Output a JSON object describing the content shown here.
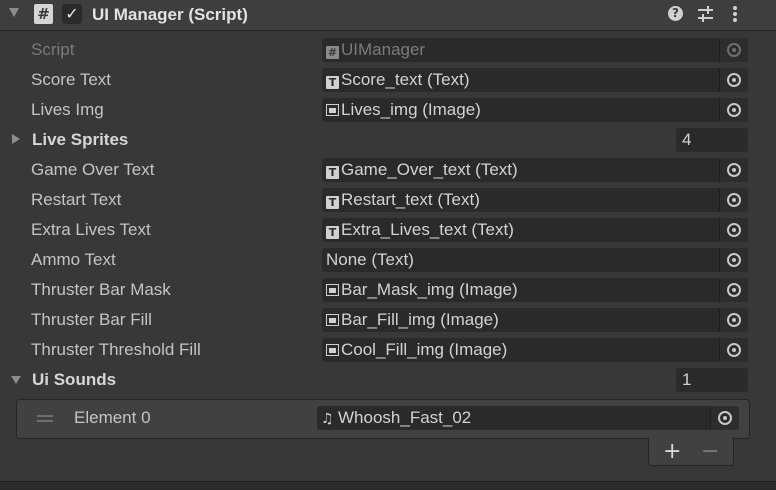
{
  "header": {
    "title": "UI Manager (Script)",
    "script_icon": "#",
    "checkbox_icon": "checkmark-icon",
    "help_icon": "?",
    "presets_icon": "sliders-icon",
    "menu_icon": "kebab-menu-icon"
  },
  "fields": [
    {
      "label": "Script",
      "value": "UIManager",
      "icon": "script-icon",
      "disabled": true
    },
    {
      "label": "Score Text",
      "value": "Score_text (Text)",
      "icon": "text-icon"
    },
    {
      "label": "Lives Img",
      "value": "Lives_img (Image)",
      "icon": "image-icon"
    },
    {
      "label": "Live Sprites",
      "count": "4",
      "foldout": "collapsed"
    },
    {
      "label": "Game Over Text",
      "value": "Game_Over_text (Text)",
      "icon": "text-icon"
    },
    {
      "label": "Restart Text",
      "value": "Restart_text (Text)",
      "icon": "text-icon"
    },
    {
      "label": "Extra Lives Text",
      "value": "Extra_Lives_text (Text)",
      "icon": "text-icon"
    },
    {
      "label": "Ammo Text",
      "value": "None (Text)",
      "icon": ""
    },
    {
      "label": "Thruster Bar Mask",
      "value": "Bar_Mask_img (Image)",
      "icon": "image-icon"
    },
    {
      "label": "Thruster Bar Fill",
      "value": "Bar_Fill_img (Image)",
      "icon": "image-icon"
    },
    {
      "label": "Thruster Threshold Fill",
      "value": "Cool_Fill_img (Image)",
      "icon": "image-icon"
    },
    {
      "label": "Ui Sounds",
      "count": "1",
      "foldout": "expanded"
    }
  ],
  "ui_sounds": {
    "elements": [
      {
        "label": "Element 0",
        "value": "Whoosh_Fast_02",
        "icon": "audio-clip-icon"
      }
    ],
    "add_label": "+",
    "remove_label": "−"
  }
}
